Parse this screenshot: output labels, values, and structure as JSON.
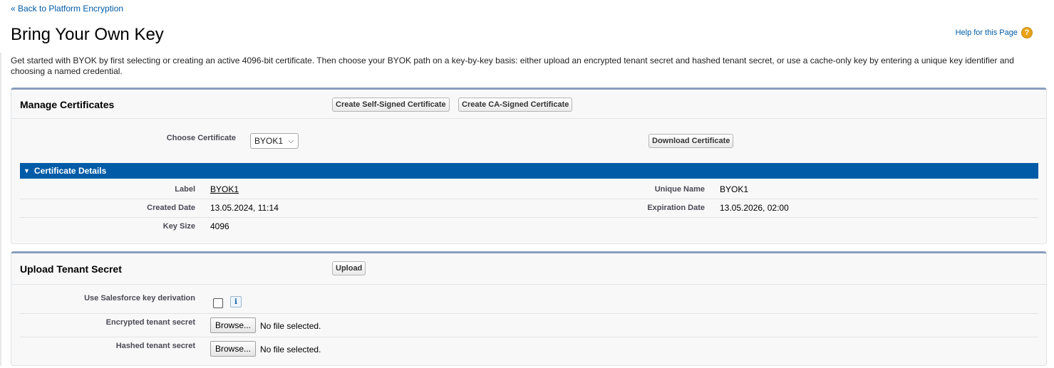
{
  "nav": {
    "back_link": "« Back to Platform Encryption",
    "help_link": "Help for this Page",
    "help_icon": "?"
  },
  "page": {
    "title": "Bring Your Own Key",
    "intro": "Get started with BYOK by first selecting or creating an active 4096-bit certificate. Then choose your BYOK path on a key-by-key basis: either upload an encrypted tenant secret and hashed tenant secret, or use a cache-only key by entering a unique key identifier and choosing a named credential."
  },
  "manage_certificates": {
    "title": "Manage Certificates",
    "create_self_signed": "Create Self-Signed Certificate",
    "create_ca_signed": "Create CA-Signed Certificate",
    "choose_label": "Choose Certificate",
    "selected_certificate": "BYOK1",
    "download_button": "Download Certificate",
    "details_header": "Certificate Details",
    "details": {
      "label_label": "Label",
      "label_value": "BYOK1",
      "unique_name_label": "Unique Name",
      "unique_name_value": "BYOK1",
      "created_label": "Created Date",
      "created_value": "13.05.2024, 11:14",
      "expiration_label": "Expiration Date",
      "expiration_value": "13.05.2026, 02:00",
      "key_size_label": "Key Size",
      "key_size_value": "4096"
    }
  },
  "upload_tenant": {
    "title": "Upload Tenant Secret",
    "upload_button": "Upload",
    "key_derivation_label": "Use Salesforce key derivation",
    "info_icon": "i",
    "encrypted_label": "Encrypted tenant secret",
    "hashed_label": "Hashed tenant secret",
    "browse_label": "Browse...",
    "no_file": "No file selected."
  },
  "colors": {
    "link": "#015ba7",
    "details_bar": "#015ba7",
    "section_border": "#8a9ebe",
    "help_icon": "#e8a317"
  }
}
